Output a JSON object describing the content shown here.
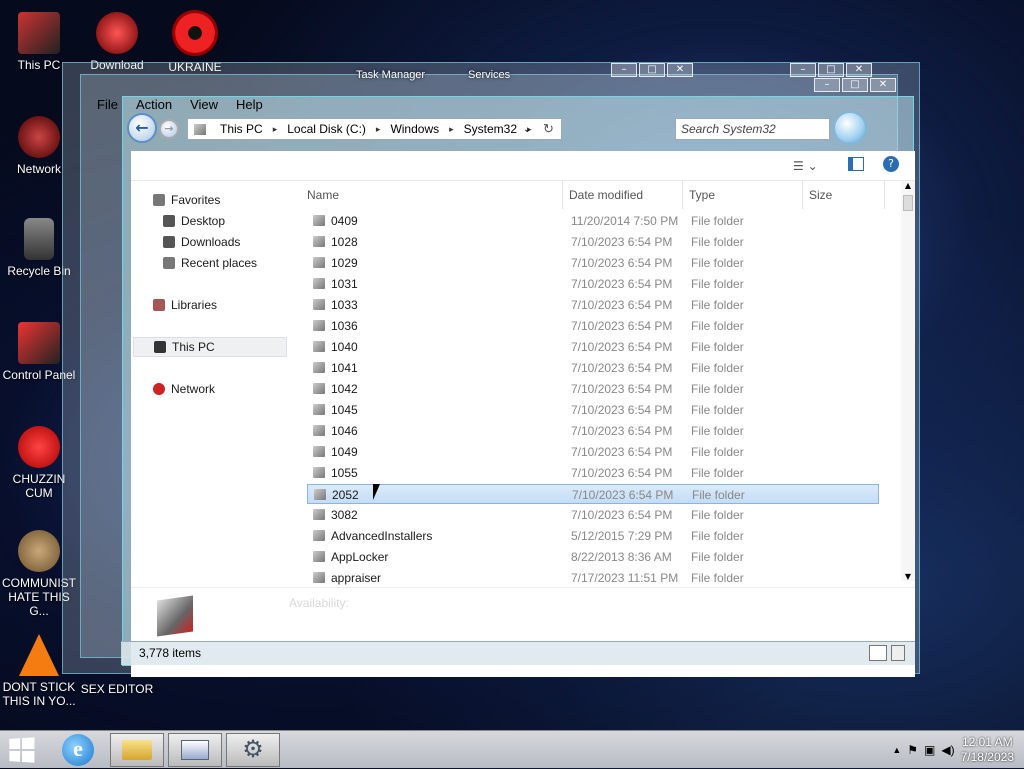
{
  "desktop": {
    "icons": [
      {
        "label": "This PC"
      },
      {
        "label": "Download"
      },
      {
        "label": "UKRAINE"
      },
      {
        "label": "Network"
      },
      {
        "label": "Recycle Bin"
      },
      {
        "label": "Control Panel"
      },
      {
        "label": "CHUZZIN CUM"
      },
      {
        "label": "COMMUNIST HATE THIS G..."
      },
      {
        "label": "DONT STICK THIS IN YO..."
      },
      {
        "label": "SEX EDITOR"
      }
    ],
    "background_ghosts": [
      "Task Manager",
      "Services"
    ]
  },
  "explorer": {
    "menu": [
      "File",
      "Action",
      "View",
      "Help"
    ],
    "address": {
      "crumbs": [
        "This PC",
        "Local Disk (C:)",
        "Windows",
        "System32"
      ]
    },
    "search_placeholder": "Search System32",
    "nav_pane": {
      "favorites": "Favorites",
      "desktop": "Desktop",
      "downloads": "Downloads",
      "recent": "Recent places",
      "libraries": "Libraries",
      "this_pc": "This PC",
      "network": "Network"
    },
    "columns": {
      "name": "Name",
      "date": "Date modified",
      "type": "Type",
      "size": "Size"
    },
    "files": [
      {
        "name": "0409",
        "date": "11/20/2014 7:50 PM",
        "type": "File folder"
      },
      {
        "name": "1028",
        "date": "7/10/2023 6:54 PM",
        "type": "File folder"
      },
      {
        "name": "1029",
        "date": "7/10/2023 6:54 PM",
        "type": "File folder"
      },
      {
        "name": "1031",
        "date": "7/10/2023 6:54 PM",
        "type": "File folder"
      },
      {
        "name": "1033",
        "date": "7/10/2023 6:54 PM",
        "type": "File folder"
      },
      {
        "name": "1036",
        "date": "7/10/2023 6:54 PM",
        "type": "File folder"
      },
      {
        "name": "1040",
        "date": "7/10/2023 6:54 PM",
        "type": "File folder"
      },
      {
        "name": "1041",
        "date": "7/10/2023 6:54 PM",
        "type": "File folder"
      },
      {
        "name": "1042",
        "date": "7/10/2023 6:54 PM",
        "type": "File folder"
      },
      {
        "name": "1045",
        "date": "7/10/2023 6:54 PM",
        "type": "File folder"
      },
      {
        "name": "1046",
        "date": "7/10/2023 6:54 PM",
        "type": "File folder"
      },
      {
        "name": "1049",
        "date": "7/10/2023 6:54 PM",
        "type": "File folder"
      },
      {
        "name": "1055",
        "date": "7/10/2023 6:54 PM",
        "type": "File folder"
      },
      {
        "name": "2052",
        "date": "7/10/2023 6:54 PM",
        "type": "File folder"
      },
      {
        "name": "3082",
        "date": "7/10/2023 6:54 PM",
        "type": "File folder"
      },
      {
        "name": "AdvancedInstallers",
        "date": "5/12/2015 7:29 PM",
        "type": "File folder"
      },
      {
        "name": "AppLocker",
        "date": "8/22/2013 8:36 AM",
        "type": "File folder"
      },
      {
        "name": "appraiser",
        "date": "7/17/2023 11:51 PM",
        "type": "File folder"
      }
    ],
    "selected_file_index": 13,
    "details_text": "Availability:",
    "status_count": "3,778 items"
  },
  "taskbar": {
    "time": "12:01 AM",
    "date": "7/18/2023"
  },
  "colors": {
    "accent": "#6fd6e6",
    "selection": "#c3dcf5"
  }
}
